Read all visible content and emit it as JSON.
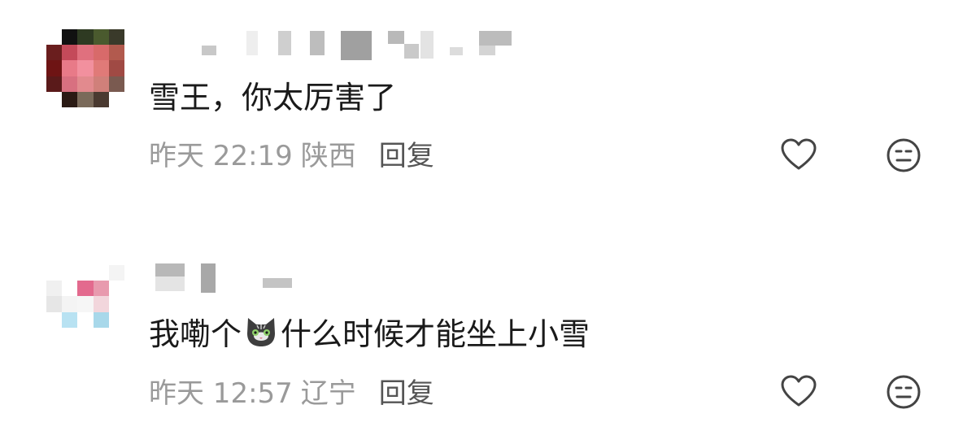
{
  "comments": [
    {
      "username": "",
      "text": "雪王，你太厉害了",
      "time": "昨天 22:19",
      "location": "陕西",
      "reply_label": "回复",
      "like_icon": "heart-outline-icon",
      "dislike_icon": "neutral-face-icon"
    },
    {
      "username": "",
      "text_before_emoji": "我嘞个",
      "emoji": "cat-emoji",
      "text_after_emoji": "什么时候才能坐上小雪",
      "time": "昨天 12:57",
      "location": "辽宁",
      "reply_label": "回复",
      "like_icon": "heart-outline-icon",
      "dislike_icon": "neutral-face-icon"
    }
  ],
  "colors": {
    "text_primary": "#1a1a1a",
    "text_meta": "#9a9a9a",
    "reply": "#555555",
    "icon": "#444444"
  }
}
